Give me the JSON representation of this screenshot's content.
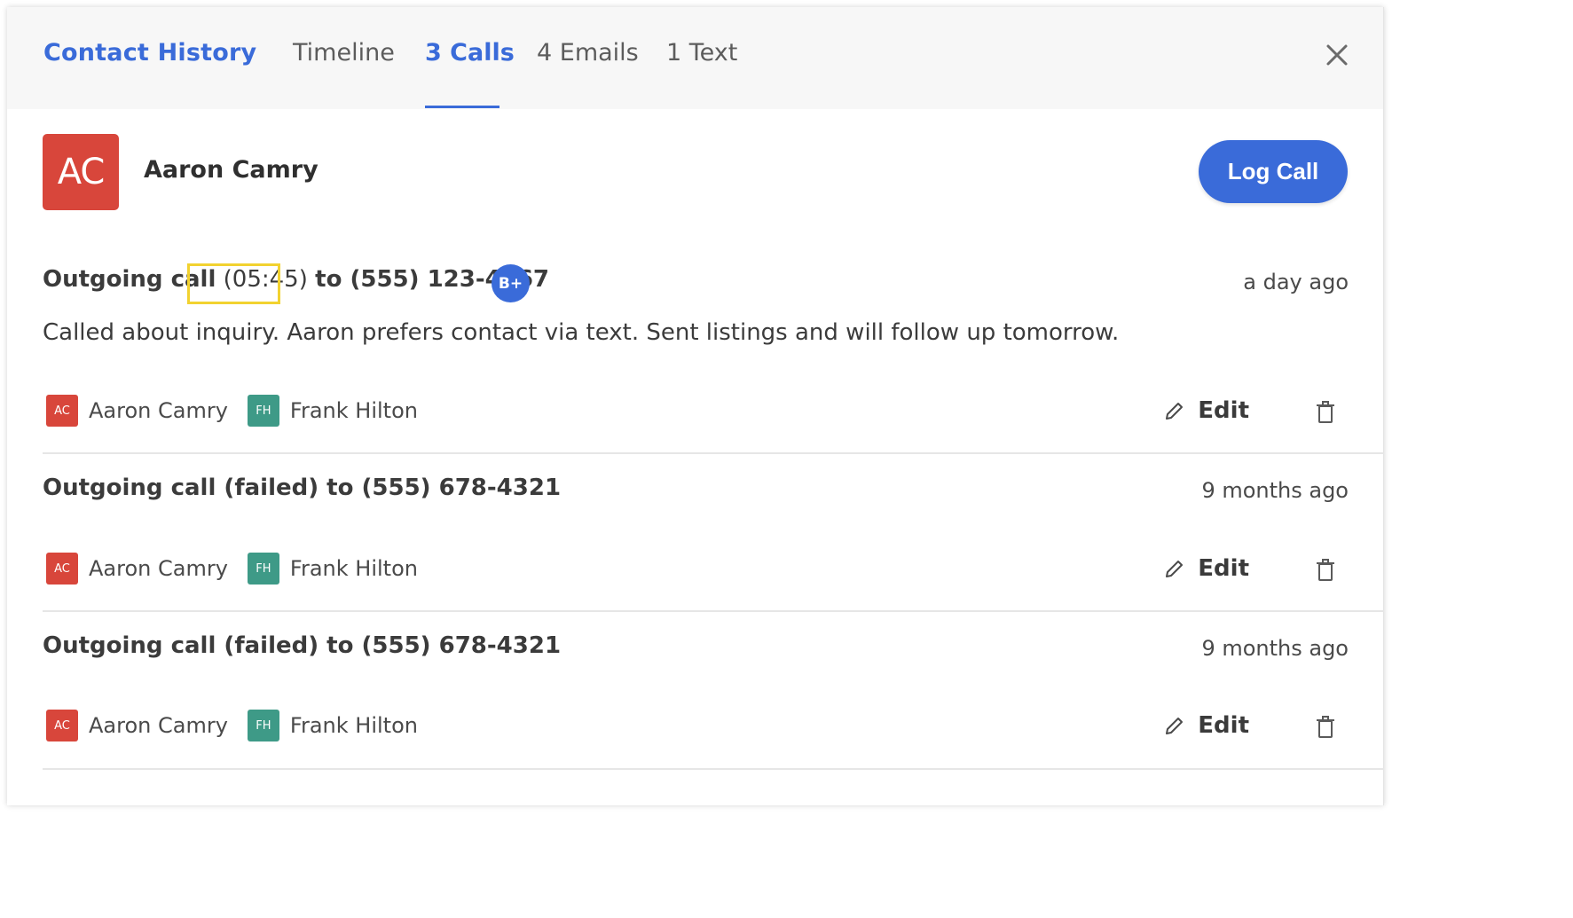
{
  "header": {
    "title": "Contact History",
    "tabs": [
      {
        "label": "Timeline",
        "active": false
      },
      {
        "label": "3 Calls",
        "active": true
      },
      {
        "label": "4 Emails",
        "active": false
      },
      {
        "label": "1 Text",
        "active": false
      }
    ],
    "close_icon": "close-icon",
    "accent_color": "#3a6bd9"
  },
  "contact": {
    "initials": "AC",
    "name": "Aaron Camry",
    "avatar_color": "#d8463b"
  },
  "actions": {
    "log_call_label": "Log Call"
  },
  "calls": [
    {
      "title_prefix": "Outgoing call",
      "duration": "(05:45)",
      "title_suffix": "to (555) 123-4567",
      "badge": "B+",
      "time": "a day ago",
      "note": "Called about inquiry. Aaron prefers contact via text. Sent listings and will follow up tomorrow.",
      "participants": [
        {
          "initials": "AC",
          "name": "Aaron Camry",
          "color": "#d8463b"
        },
        {
          "initials": "FH",
          "name": "Frank Hilton",
          "color": "#3e9a87"
        }
      ],
      "edit_label": "Edit"
    },
    {
      "title": "Outgoing call (failed) to (555) 678-4321",
      "time": "9 months ago",
      "participants": [
        {
          "initials": "AC",
          "name": "Aaron Camry",
          "color": "#d8463b"
        },
        {
          "initials": "FH",
          "name": "Frank Hilton",
          "color": "#3e9a87"
        }
      ],
      "edit_label": "Edit"
    },
    {
      "title": "Outgoing call (failed) to (555) 678-4321",
      "time": "9 months ago",
      "participants": [
        {
          "initials": "AC",
          "name": "Aaron Camry",
          "color": "#d8463b"
        },
        {
          "initials": "FH",
          "name": "Frank Hilton",
          "color": "#3e9a87"
        }
      ],
      "edit_label": "Edit"
    }
  ]
}
